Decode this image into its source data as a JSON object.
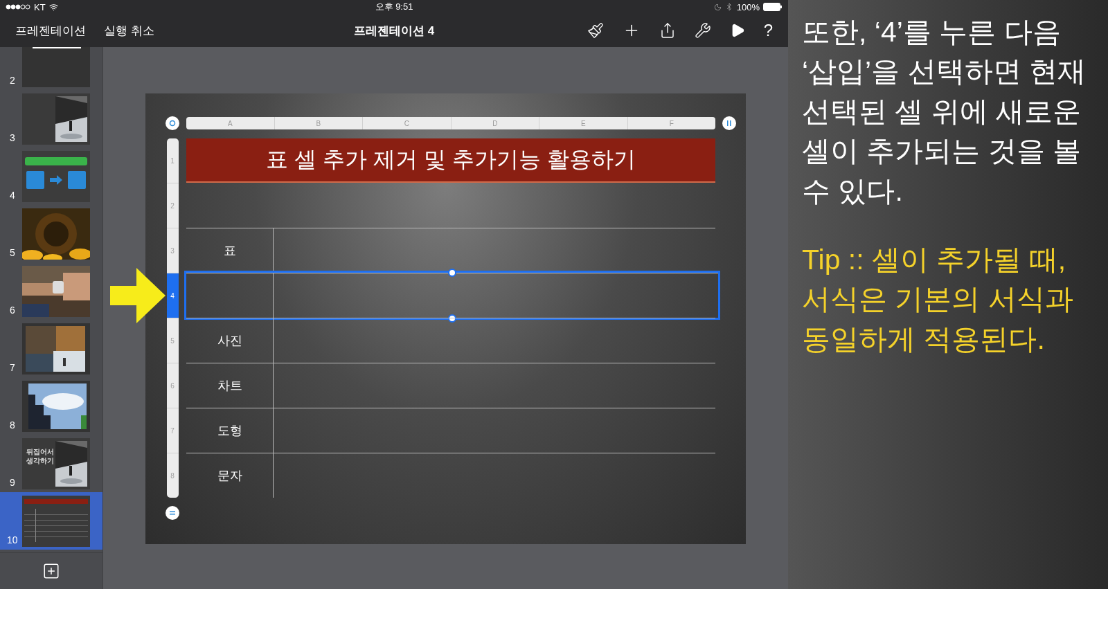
{
  "status_bar": {
    "carrier": "KT",
    "time": "오후 9:51",
    "battery": "100%"
  },
  "toolbar": {
    "back": "프레젠테이션",
    "undo": "실행 취소",
    "title": "프레젠테이션 4",
    "help": "?"
  },
  "slides": [
    {
      "number": "2",
      "kind": "titled",
      "selected": false
    },
    {
      "number": "3",
      "kind": "split",
      "selected": false
    },
    {
      "number": "4",
      "kind": "diagram",
      "selected": false
    },
    {
      "number": "5",
      "kind": "picture",
      "selected": false
    },
    {
      "number": "6",
      "kind": "picture",
      "selected": false
    },
    {
      "number": "7",
      "kind": "picture",
      "selected": false
    },
    {
      "number": "8",
      "kind": "picture",
      "selected": false
    },
    {
      "number": "9",
      "kind": "split",
      "title": "뒤집어서 생각하기",
      "selected": false
    },
    {
      "number": "10",
      "kind": "table",
      "selected": true
    }
  ],
  "table": {
    "columns": [
      "A",
      "B",
      "C",
      "D",
      "E",
      "F"
    ],
    "rows": [
      {
        "number": "1",
        "kind": "title",
        "label": "표 셀 추가 제거 및 추가기능 활용하기",
        "selected": false
      },
      {
        "number": "2",
        "kind": "plain",
        "selected": false
      },
      {
        "number": "3",
        "kind": "plain",
        "label": "표",
        "selected": false
      },
      {
        "number": "4",
        "kind": "plain",
        "selected": true
      },
      {
        "number": "5",
        "kind": "plain",
        "label": "사진",
        "selected": false
      },
      {
        "number": "6",
        "kind": "plain",
        "label": "차트",
        "selected": false
      },
      {
        "number": "7",
        "kind": "plain",
        "label": "도형",
        "selected": false
      },
      {
        "number": "8",
        "kind": "plain",
        "label": "문자",
        "selected": false
      }
    ]
  },
  "notes": [
    {
      "kind": "main",
      "text": "또한, ‘4’를 누른 다음 ‘삽입’을 선택하면 현재 선택된 셀 위에 새로운 셀이 추가되는 것을 볼 수 있다."
    },
    {
      "kind": "tip",
      "text": "Tip :: 셀이 추가될 때, 서식은 기본의 서식과 동일하게 적용된다."
    }
  ]
}
